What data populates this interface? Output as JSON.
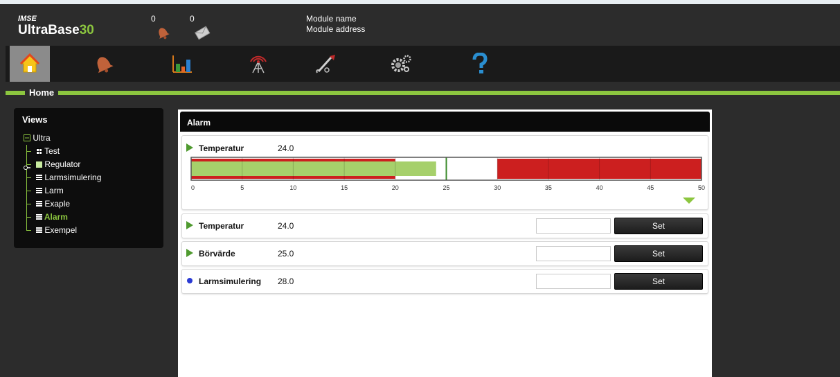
{
  "app": {
    "brand_small": "IMSE",
    "brand_text": "UltraBase",
    "brand_number": "30"
  },
  "header": {
    "alarm_count": "0",
    "message_count": "0",
    "module_name_label": "Module name",
    "module_address_label": "Module address"
  },
  "nav": {
    "items": [
      {
        "icon": "home-icon",
        "active": true
      },
      {
        "icon": "bell-icon"
      },
      {
        "icon": "bar-chart-icon"
      },
      {
        "icon": "antenna-icon"
      },
      {
        "icon": "tools-icon"
      },
      {
        "icon": "gears-icon"
      },
      {
        "icon": "help-icon"
      }
    ]
  },
  "breadcrumb": {
    "label": "Home"
  },
  "views": {
    "title": "Views",
    "root": "Ultra",
    "items": [
      {
        "label": "Test",
        "icon": "grid-icon"
      },
      {
        "label": "Regulator",
        "icon": "square-icon"
      },
      {
        "label": "Larmsimulering",
        "icon": "list-icon"
      },
      {
        "label": "Larm",
        "icon": "list-icon"
      },
      {
        "label": "Exaple",
        "icon": "list-icon"
      },
      {
        "label": "Alarm",
        "icon": "list-icon",
        "selected": true
      },
      {
        "label": "Exempel",
        "icon": "list-icon"
      }
    ]
  },
  "panel": {
    "title": "Alarm",
    "gauge": {
      "label": "Temperatur",
      "value": "24.0",
      "current_value": 24.0,
      "setpoint": 25,
      "ticks": [
        "0",
        "5",
        "10",
        "15",
        "20",
        "25",
        "30",
        "35",
        "40",
        "45",
        "50"
      ],
      "scale_min": 0,
      "scale_max": 50,
      "low_alarm_limit": 20,
      "high_alarm_limit": 30,
      "alarm_color": "#cc1f1f",
      "value_color": "#a6d06b",
      "setpoint_color": "#3a8a2a"
    },
    "rows": [
      {
        "label": "Temperatur",
        "value": "24.0",
        "marker": "arrow",
        "input": "",
        "button": "Set"
      },
      {
        "label": "Börvärde",
        "value": "25.0",
        "marker": "arrow",
        "input": "",
        "button": "Set"
      },
      {
        "label": "Larmsimulering",
        "value": "28.0",
        "marker": "dot",
        "input": "",
        "button": "Set"
      }
    ]
  },
  "colors": {
    "accent": "#8cc63f",
    "background": "#2c2c2c"
  }
}
